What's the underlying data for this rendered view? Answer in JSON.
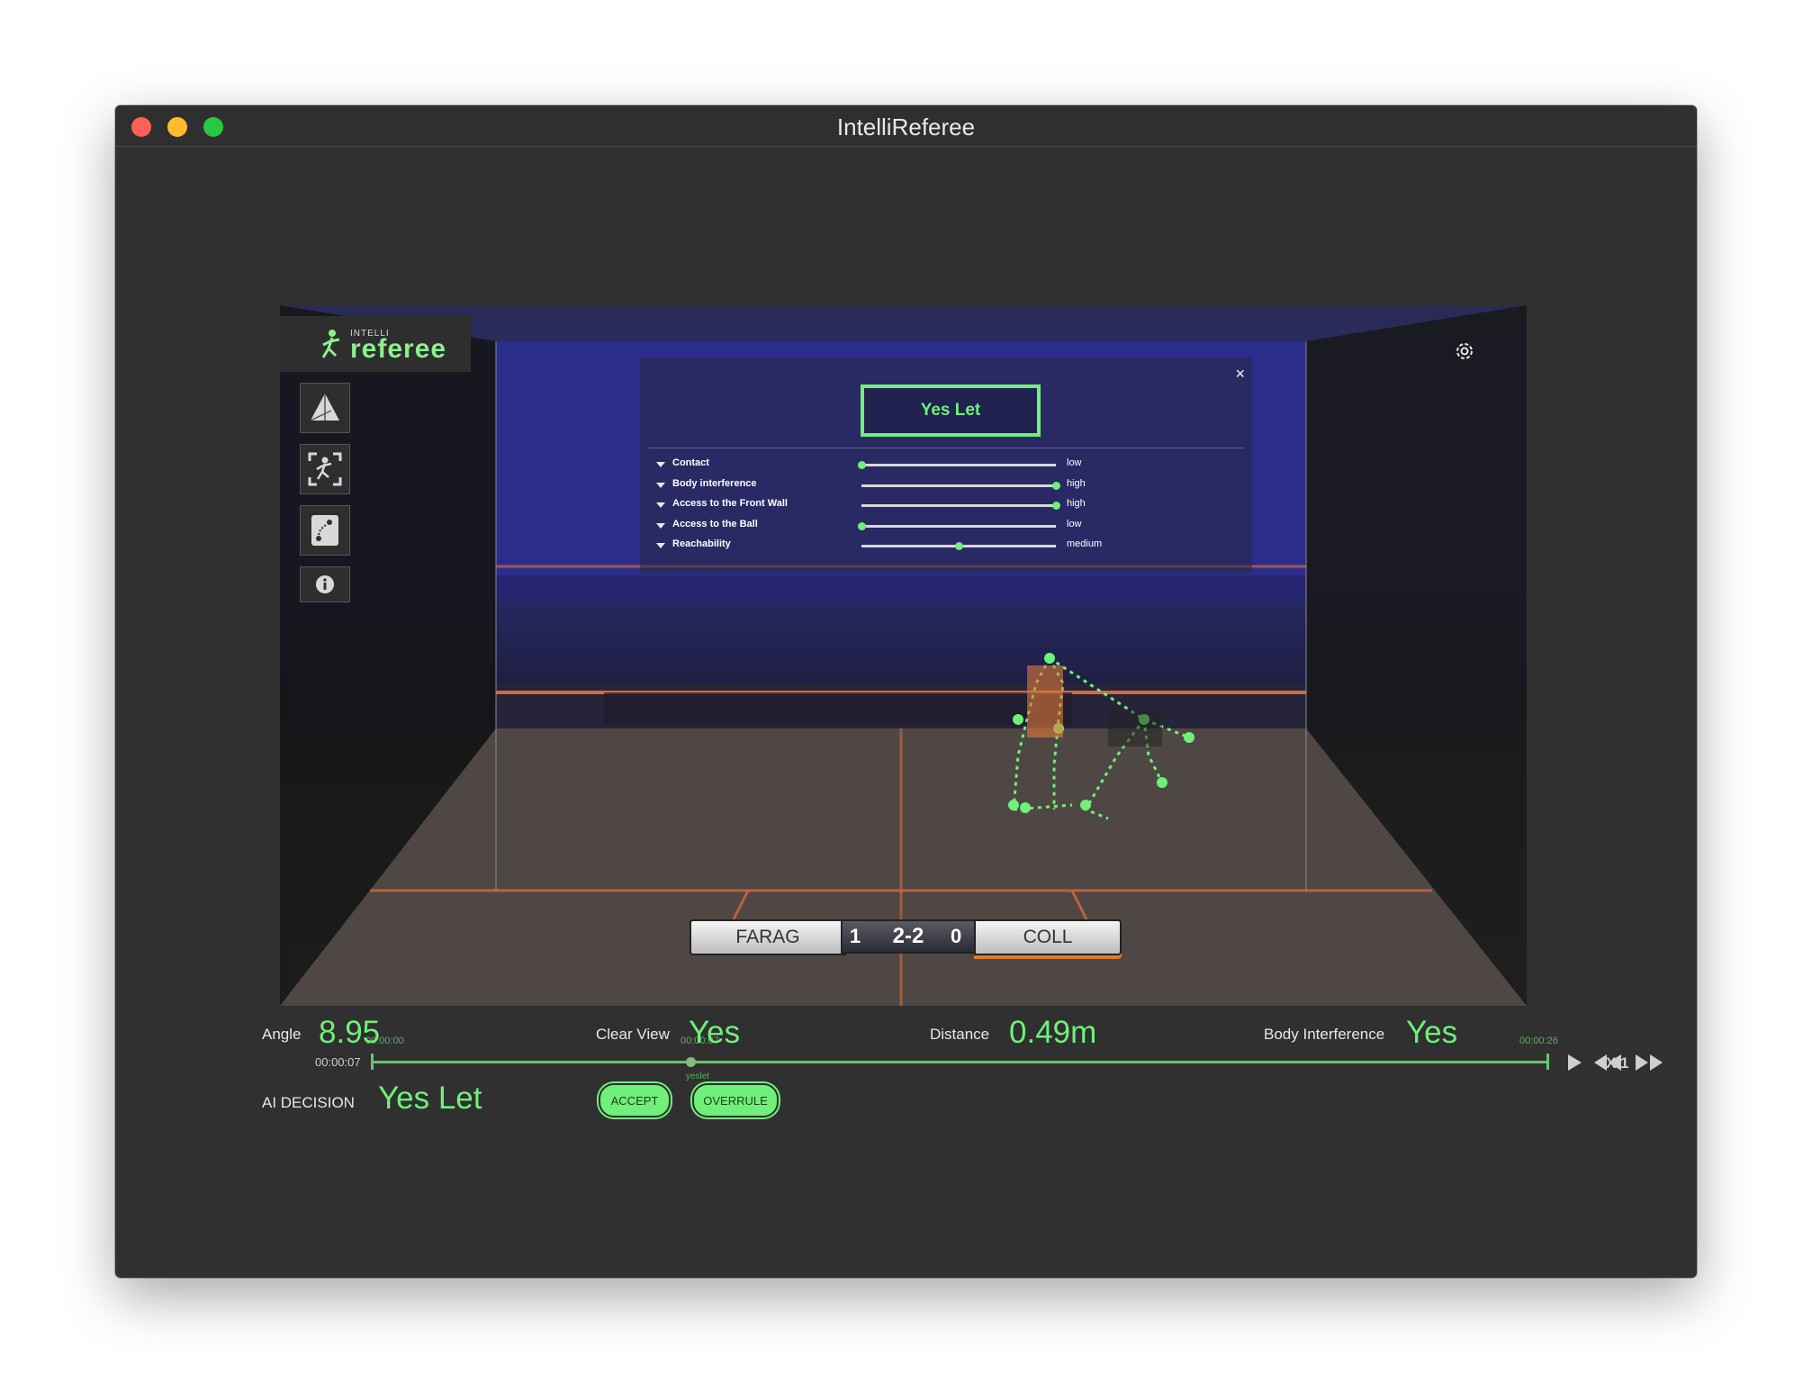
{
  "window": {
    "title": "IntelliReferee"
  },
  "app": {
    "logo_small": "INTELLI",
    "logo_main": "referee"
  },
  "overlay": {
    "decision": "Yes Let",
    "close_label": "×",
    "criteria": [
      {
        "label": "Contact",
        "level": "low",
        "value": 0.0
      },
      {
        "label": "Body interference",
        "level": "high",
        "value": 1.0
      },
      {
        "label": "Access to the Front Wall",
        "level": "high",
        "value": 1.0
      },
      {
        "label": "Access to the Ball",
        "level": "low",
        "value": 0.0
      },
      {
        "label": "Reachability",
        "level": "medium",
        "value": 0.5
      }
    ]
  },
  "scoreboard": {
    "player_left": "FARAG",
    "games_left": "1",
    "score": "2-2",
    "games_right": "0",
    "player_right": "COLL"
  },
  "timeline": {
    "start": "00:00:00",
    "mid": "00:00:07",
    "end": "00:00:26",
    "current": "00:00:07",
    "marker_label": "yeslet",
    "progress": 0.27,
    "speed": "X 1"
  },
  "stats": {
    "angle_label": "Angle",
    "angle_value": "8.95",
    "clear_view_label": "Clear View",
    "clear_view_value": "Yes",
    "distance_label": "Distance",
    "distance_value": "0.49m",
    "body_int_label": "Body Interference",
    "body_int_value": "Yes",
    "ai_label": "AI DECISION",
    "ai_value": "Yes Let",
    "accept_label": "ACCEPT",
    "overrule_label": "OVERRULE"
  },
  "colors": {
    "accent": "#6ff07a",
    "window_bg": "#303030",
    "timeline": "#68c46c"
  }
}
